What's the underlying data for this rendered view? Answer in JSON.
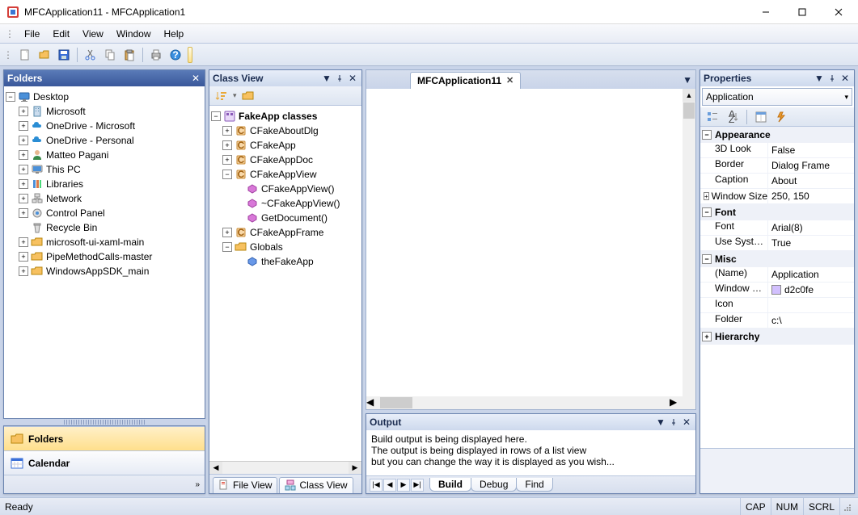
{
  "window": {
    "title": "MFCApplication11 - MFCApplication1"
  },
  "menu": {
    "file": "File",
    "edit": "Edit",
    "view": "View",
    "window": "Window",
    "help": "Help"
  },
  "folders_panel": {
    "title": "Folders",
    "tree": {
      "root": "Desktop",
      "items": [
        "Microsoft",
        "OneDrive - Microsoft",
        "OneDrive - Personal",
        "Matteo Pagani",
        "This PC",
        "Libraries",
        "Network",
        "Control Panel",
        "Recycle Bin",
        "microsoft-ui-xaml-main",
        "PipeMethodCalls-master",
        "WindowsAppSDK_main"
      ]
    },
    "nav": {
      "folders": "Folders",
      "calendar": "Calendar"
    }
  },
  "classview": {
    "title": "Class View",
    "root": "FakeApp classes",
    "classes": [
      "CFakeAboutDlg",
      "CFakeApp",
      "CFakeAppDoc"
    ],
    "expanded_class": "CFakeAppView",
    "members": [
      "CFakeAppView()",
      "~CFakeAppView()",
      "GetDocument()"
    ],
    "after": [
      "CFakeAppFrame"
    ],
    "globals": "Globals",
    "global_item": "theFakeApp",
    "tabs": {
      "file": "File View",
      "class": "Class View"
    }
  },
  "document": {
    "tab": "MFCApplication11"
  },
  "properties": {
    "title": "Properties",
    "object": "Application",
    "cats": {
      "appearance": "Appearance",
      "font": "Font",
      "misc": "Misc",
      "hierarchy": "Hierarchy"
    },
    "rows": {
      "look": {
        "k": "3D Look",
        "v": "False"
      },
      "border": {
        "k": "Border",
        "v": "Dialog Frame"
      },
      "caption": {
        "k": "Caption",
        "v": "About"
      },
      "winsize": {
        "k": "Window Size",
        "v": "250, 150"
      },
      "font": {
        "k": "Font",
        "v": "Arial(8)"
      },
      "usesys": {
        "k": "Use System ...",
        "v": "True"
      },
      "name": {
        "k": "(Name)",
        "v": "Application"
      },
      "wincolor": {
        "k": "Window Co...",
        "v": "d2c0fe",
        "swatch": "#d2c0fe"
      },
      "icon": {
        "k": "Icon",
        "v": ""
      },
      "folder": {
        "k": "Folder",
        "v": "c:\\"
      }
    }
  },
  "output": {
    "title": "Output",
    "lines": [
      "Build output is being displayed here.",
      "The output is being displayed in rows of a list view",
      "but you can change the way it is displayed as you wish..."
    ],
    "tabs": {
      "build": "Build",
      "debug": "Debug",
      "find": "Find"
    }
  },
  "status": {
    "ready": "Ready",
    "cap": "CAP",
    "num": "NUM",
    "scrl": "SCRL"
  }
}
